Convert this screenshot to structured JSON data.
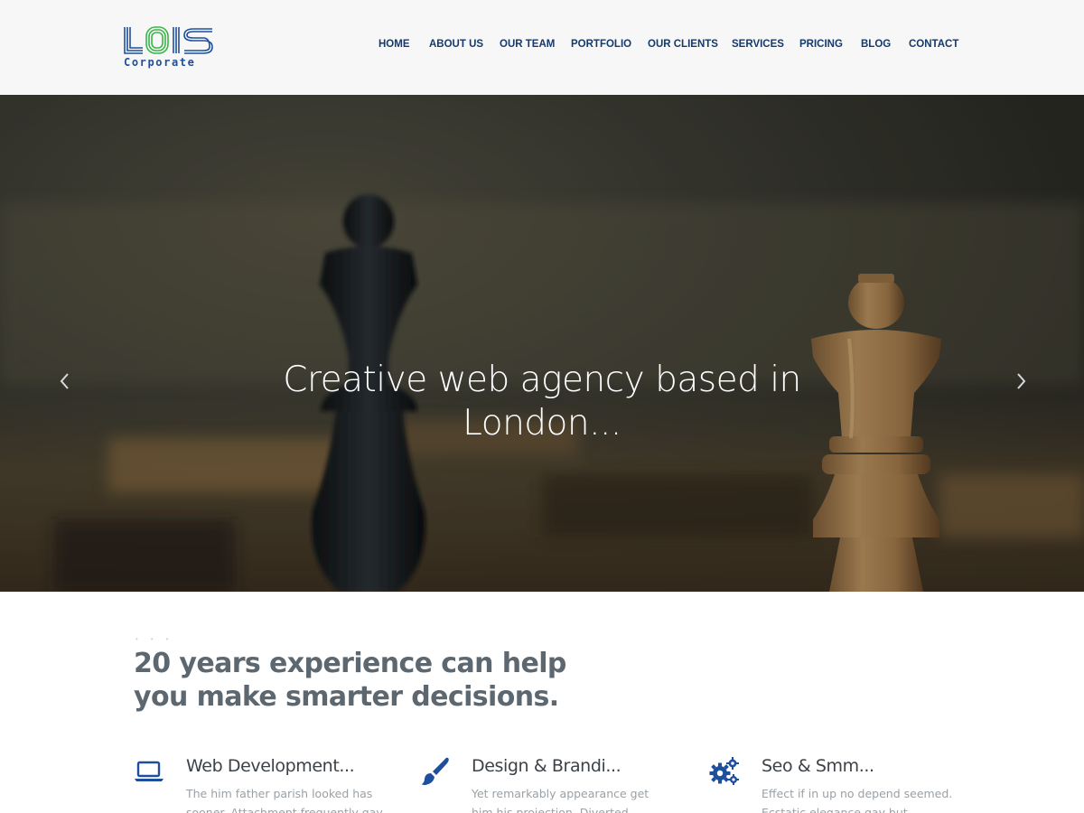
{
  "brand": {
    "logo_main": "LOIS",
    "logo_sub": "Corporate",
    "color_primary": "#1e4f9c",
    "color_accent": "#3bb54a"
  },
  "nav": {
    "items": [
      {
        "label": "HOME"
      },
      {
        "label": "ABOUT US"
      },
      {
        "label": "OUR TEAM"
      },
      {
        "label": "PORTFOLIO"
      },
      {
        "label": "OUR CLIENTS"
      },
      {
        "label": "SERVICES"
      },
      {
        "label": "PRICING"
      },
      {
        "label": "BLOG"
      },
      {
        "label": "CONTACT"
      }
    ],
    "color": "#15396b"
  },
  "hero": {
    "title": "Creative web agency based in London...",
    "prev_icon": "chevron-left-icon",
    "next_icon": "chevron-right-icon"
  },
  "intro": {
    "title": "20 years experience can help you make smarter decisions."
  },
  "services": [
    {
      "icon": "laptop-icon",
      "title": "Web Development...",
      "text": "The him father parish looked has sooner. Attachment frequently gay"
    },
    {
      "icon": "paintbrush-icon",
      "title": "Design & Brandi...",
      "text": "Yet remarkably appearance get him his projection. Diverted endeavor bed"
    },
    {
      "icon": "gears-icon",
      "title": "Seo & Smm...",
      "text": "Effect if in up no depend seemed. Ecstatic elegance gay but disposed"
    }
  ]
}
